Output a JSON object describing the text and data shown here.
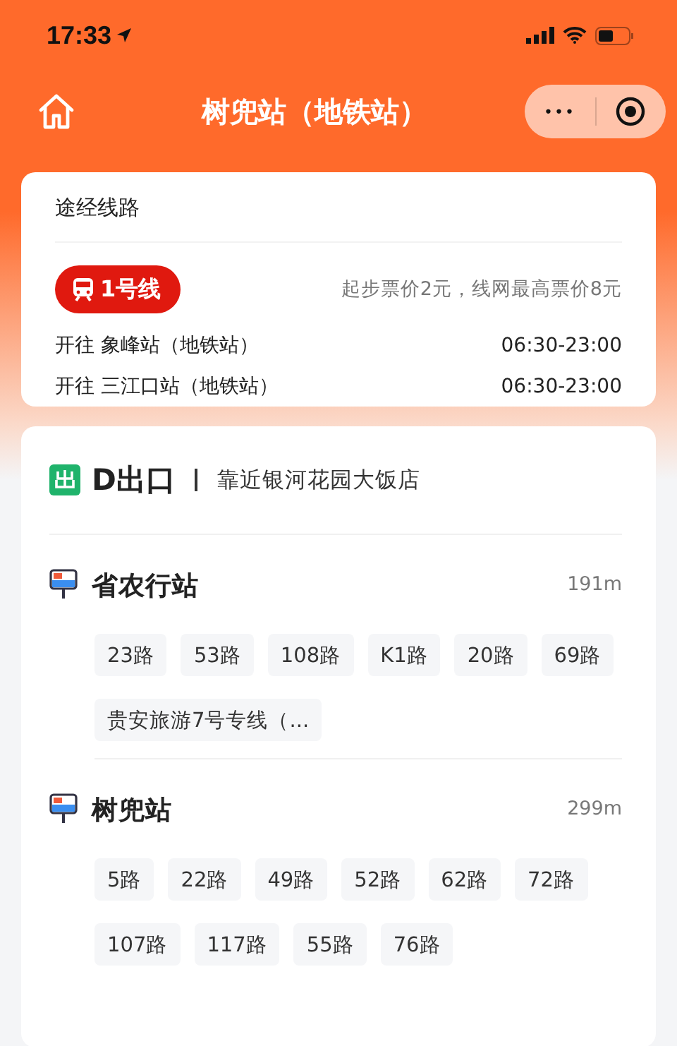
{
  "status_bar": {
    "time": "17:33"
  },
  "nav": {
    "title": "树兜站（地铁站）",
    "more": "•••"
  },
  "routes_card": {
    "title": "途经线路",
    "line": {
      "name": "1号线",
      "color": "#e0190f"
    },
    "fare": "起步票价2元，线网最高票价8元",
    "directions": [
      {
        "label": "开往 象峰站（地铁站）",
        "hours": "06:30-23:00"
      },
      {
        "label": "开往 三江口站（地铁站）",
        "hours": "06:30-23:00"
      }
    ]
  },
  "exit": {
    "name": "D出口",
    "landmark": "靠近银河花园大饭店",
    "stops": [
      {
        "name": "省农行站",
        "distance": "191m",
        "buses": [
          "23路",
          "53路",
          "108路",
          "K1路",
          "20路",
          "69路",
          "贵安旅游7号专线（..."
        ]
      },
      {
        "name": "树兜站",
        "distance": "299m",
        "buses": [
          "5路",
          "22路",
          "49路",
          "52路",
          "62路",
          "72路",
          "107路",
          "117路",
          "55路",
          "76路"
        ]
      }
    ]
  }
}
